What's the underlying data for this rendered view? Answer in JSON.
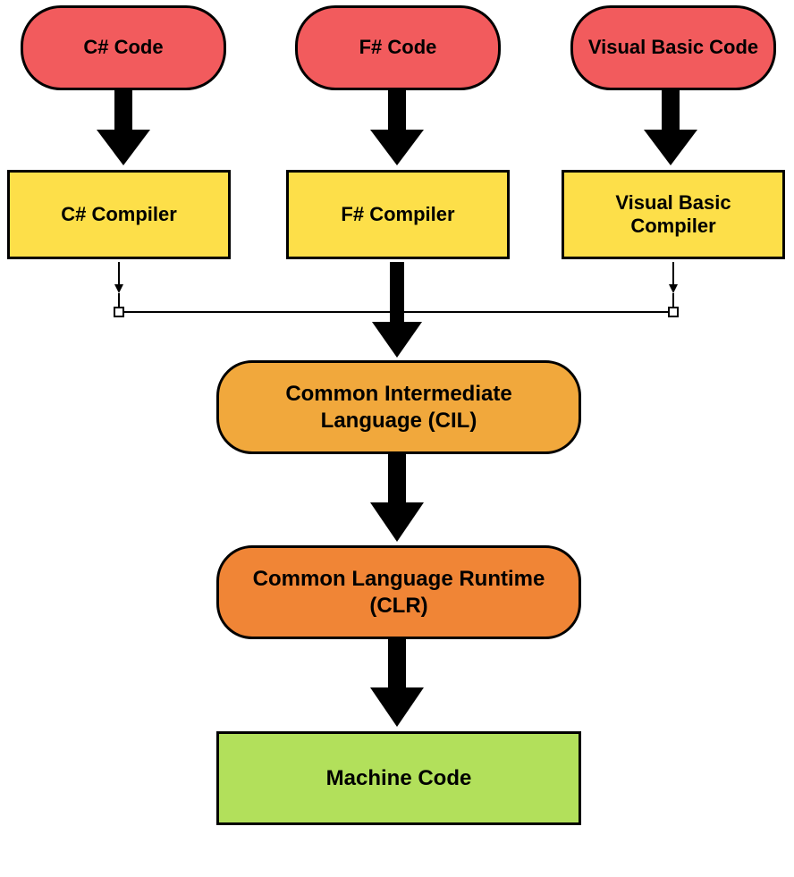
{
  "nodes": {
    "csharp_code": "C# Code",
    "fsharp_code": "F# Code",
    "vb_code": "Visual Basic Code",
    "csharp_compiler": "C# Compiler",
    "fsharp_compiler": "F# Compiler",
    "vb_compiler": "Visual Basic Compiler",
    "cil": "Common Intermediate Language (CIL)",
    "clr": "Common Language Runtime (CLR)",
    "machine_code": "Machine Code"
  },
  "colors": {
    "red": "#f25b5d",
    "yellow": "#fddf49",
    "orange_light": "#f1a83c",
    "orange_dark": "#f08536",
    "green": "#b2e05b"
  }
}
